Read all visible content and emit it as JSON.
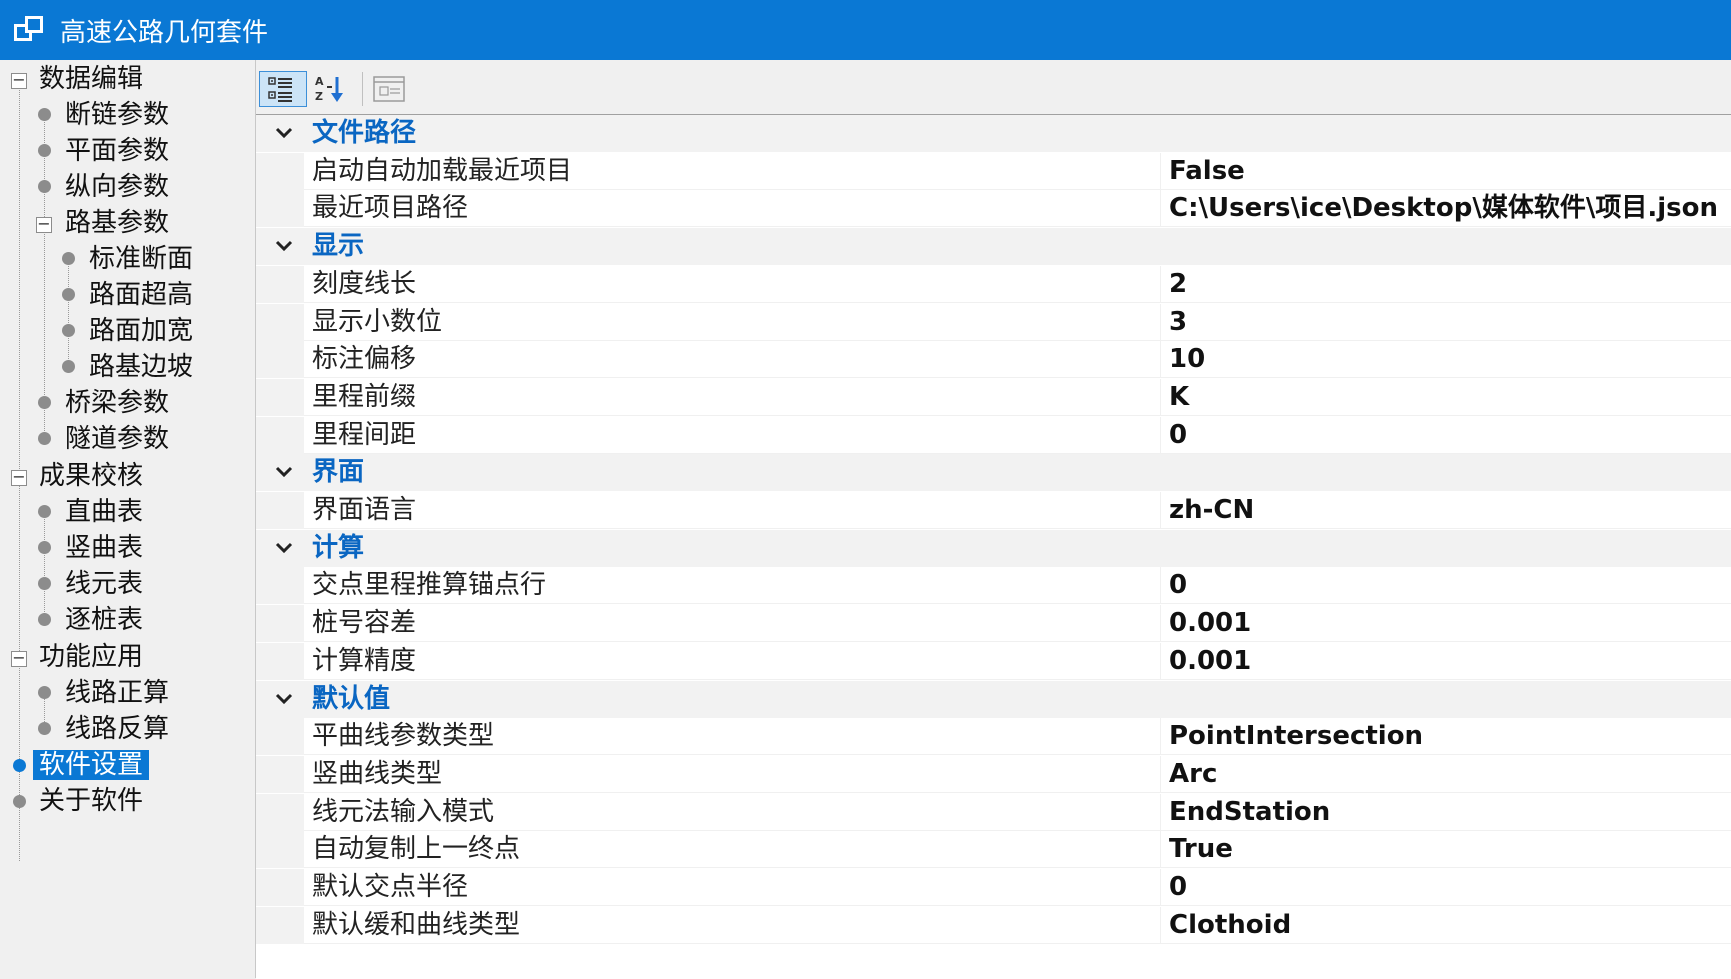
{
  "window": {
    "title": "高速公路几何套件"
  },
  "tree": {
    "groups": [
      {
        "label": "数据编辑",
        "children": [
          {
            "label": "断链参数"
          },
          {
            "label": "平面参数"
          },
          {
            "label": "纵向参数"
          },
          {
            "label": "路基参数",
            "children": [
              {
                "label": "标准断面"
              },
              {
                "label": "路面超高"
              },
              {
                "label": "路面加宽"
              },
              {
                "label": "路基边坡"
              }
            ]
          },
          {
            "label": "桥梁参数"
          },
          {
            "label": "隧道参数"
          }
        ]
      },
      {
        "label": "成果校核",
        "children": [
          {
            "label": "直曲表"
          },
          {
            "label": "竖曲表"
          },
          {
            "label": "线元表"
          },
          {
            "label": "逐桩表"
          }
        ]
      },
      {
        "label": "功能应用",
        "children": [
          {
            "label": "线路正算"
          },
          {
            "label": "线路反算"
          }
        ]
      }
    ],
    "leaves": [
      {
        "label": "软件设置",
        "selected": true
      },
      {
        "label": "关于软件"
      }
    ]
  },
  "toolbar": {
    "buttons": [
      {
        "icon": "categorized-view-icon",
        "active": true
      },
      {
        "icon": "sort-alphabetical-icon",
        "active": false
      },
      {
        "icon": "property-pages-icon",
        "active": false
      }
    ]
  },
  "properties": {
    "categories": [
      {
        "label": "文件路径",
        "items": [
          {
            "name": "启动自动加载最近项目",
            "value": "False"
          },
          {
            "name": "最近项目路径",
            "value": "C:\\Users\\ice\\Desktop\\媒体软件\\项目.json"
          }
        ]
      },
      {
        "label": "显示",
        "items": [
          {
            "name": "刻度线长",
            "value": "2"
          },
          {
            "name": "显示小数位",
            "value": "3"
          },
          {
            "name": "标注偏移",
            "value": "10"
          },
          {
            "name": "里程前缀",
            "value": "K"
          },
          {
            "name": "里程间距",
            "value": "0"
          }
        ]
      },
      {
        "label": "界面",
        "items": [
          {
            "name": "界面语言",
            "value": "zh-CN"
          }
        ]
      },
      {
        "label": "计算",
        "items": [
          {
            "name": "交点里程推算锚点行",
            "value": "0"
          },
          {
            "name": "桩号容差",
            "value": "0.001"
          },
          {
            "name": "计算精度",
            "value": "0.001"
          }
        ]
      },
      {
        "label": "默认值",
        "items": [
          {
            "name": "平曲线参数类型",
            "value": "PointIntersection"
          },
          {
            "name": "竖曲线类型",
            "value": "Arc"
          },
          {
            "name": "线元法输入模式",
            "value": "EndStation"
          },
          {
            "name": "自动复制上一终点",
            "value": "True"
          },
          {
            "name": "默认交点半径",
            "value": "0"
          },
          {
            "name": "默认缓和曲线类型",
            "value": "Clothoid"
          }
        ]
      }
    ]
  },
  "colors": {
    "accent": "#0a78d4",
    "category_text": "#0a66c2"
  }
}
